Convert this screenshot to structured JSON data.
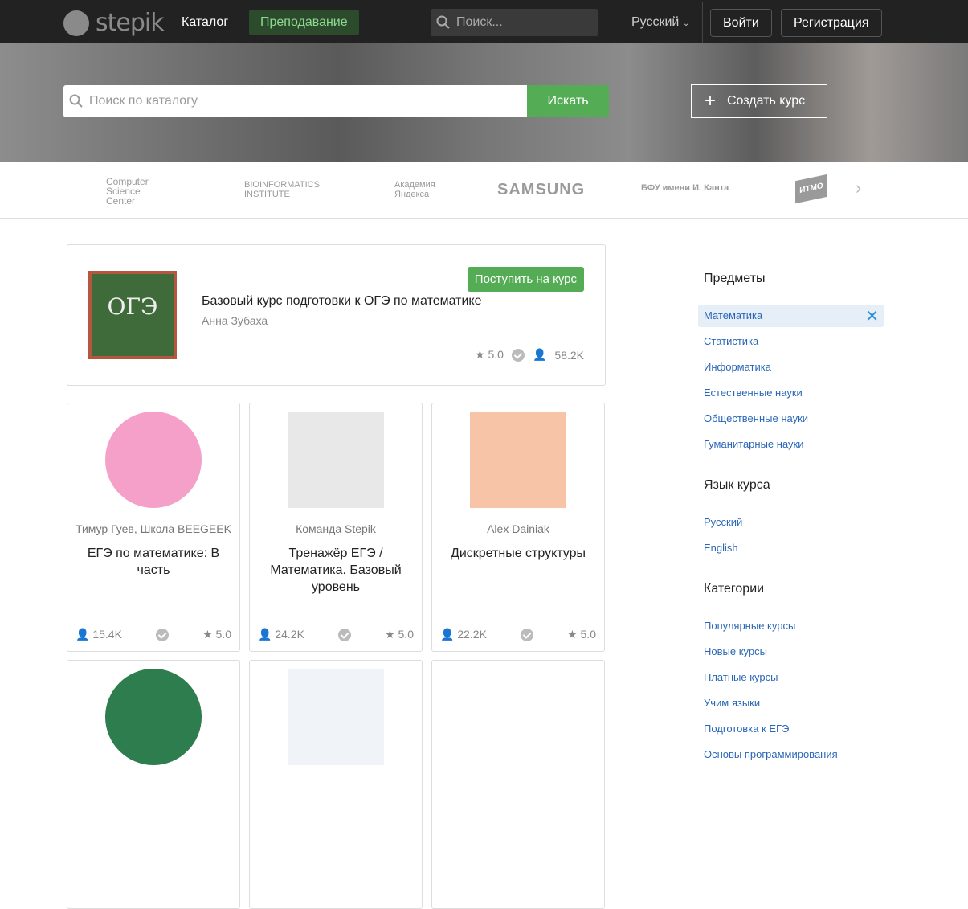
{
  "nav": {
    "logo": "stepik",
    "catalog": "Каталог",
    "teach": "Преподавание",
    "search_placeholder": "Поиск...",
    "language": "Русский",
    "login": "Войти",
    "register": "Регистрация"
  },
  "hero": {
    "search_placeholder": "Поиск по каталогу",
    "search_button": "Искать",
    "create_course": "Создать курс"
  },
  "partners": [
    "Computer Science Center",
    "BIOINFORMATICS INSTITUTE",
    "Академия Яндекса",
    "SAMSUNG",
    "БФУ имени И. Канта",
    "ИТМО"
  ],
  "featured": {
    "title": "Базовый курс подготовки к ОГЭ по математике",
    "author": "Анна Зубаха",
    "enroll": "Поступить на курс",
    "rating": "★ 5.0",
    "learners": "58.2K",
    "thumb_text": "ОГЭ"
  },
  "courses": [
    {
      "author": "Тимур Гуев,  Школа BEEGEEK",
      "title": "ЕГЭ по математике: В часть",
      "learners": "15.4K",
      "rating": "★ 5.0",
      "color": "#f4a0c8"
    },
    {
      "author": "Команда Stepik",
      "title": "Тренажёр ЕГЭ / Математика. Базовый уровень",
      "learners": "24.2K",
      "rating": "★ 5.0",
      "color": "#e8e8e8"
    },
    {
      "author": "Alex Dainiak",
      "title": "Дискретные структуры",
      "learners": "22.2K",
      "rating": "★ 5.0",
      "color": "#f8c4a8"
    },
    {
      "author": "",
      "title": "",
      "learners": "",
      "rating": "",
      "color": "#2e7d4f"
    },
    {
      "author": "",
      "title": "",
      "learners": "",
      "rating": "",
      "color": "#f0f4f8"
    },
    {
      "author": "",
      "title": "",
      "learners": "",
      "rating": "",
      "color": "#ffffff"
    }
  ],
  "sidebar": {
    "subjects_title": "Предметы",
    "subjects": [
      "Математика",
      "Статистика",
      "Информатика",
      "Естественные науки",
      "Общественные науки",
      "Гуманитарные науки"
    ],
    "language_title": "Язык курса",
    "languages": [
      "Русский",
      "English"
    ],
    "categories_title": "Категории",
    "categories": [
      "Популярные курсы",
      "Новые курсы",
      "Платные курсы",
      "Учим языки",
      "Подготовка к ЕГЭ",
      "Основы программирования"
    ]
  }
}
